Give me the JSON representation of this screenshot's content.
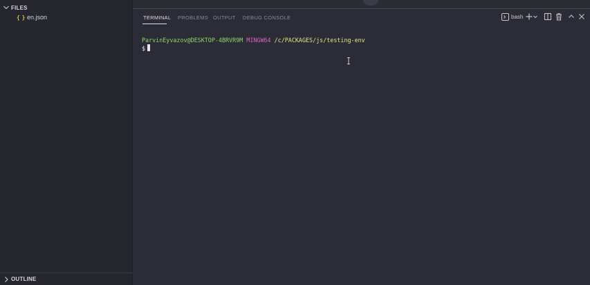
{
  "sidebar": {
    "files_header": "FILES",
    "files": [
      {
        "icon": "json-file-icon",
        "icon_glyph": "{ }",
        "name": "en.json"
      }
    ],
    "outline_header": "OUTLINE"
  },
  "panel": {
    "tabs": [
      {
        "label": "TERMINAL",
        "active": true
      },
      {
        "label": "PROBLEMS",
        "active": false
      },
      {
        "label": "OUTPUT",
        "active": false
      },
      {
        "label": "DEBUG CONSOLE",
        "active": false
      }
    ],
    "terminal_selector": "bash"
  },
  "terminal": {
    "user_host": "ParvinEyvazov@DESKTOP-4BRVR9M",
    "system": "MINGW64",
    "cwd": "/c/PACKAGES/js/testing-env",
    "prompt_symbol": "$"
  },
  "colors": {
    "background": "#2b2c35",
    "sidebar": "#26272e",
    "user": "#8dd66b",
    "mingw": "#d965c8",
    "path": "#e8e38a",
    "json_icon": "#e2c04c"
  }
}
